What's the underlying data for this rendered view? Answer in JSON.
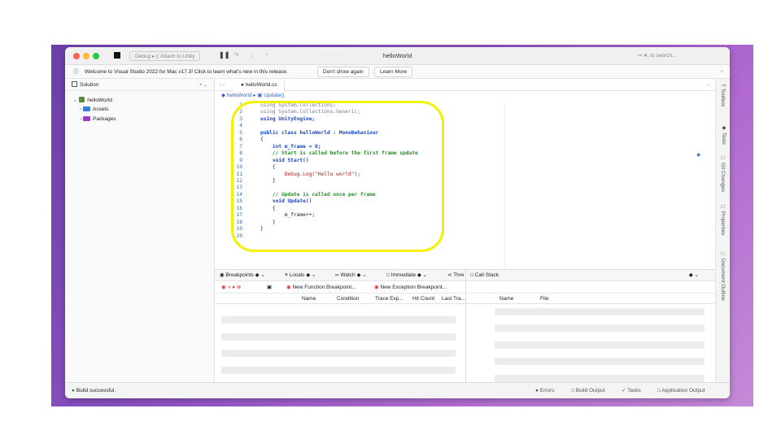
{
  "window": {
    "title": "helloWorld"
  },
  "toolbar": {
    "config": "Debug ▸ ▯ Attach to Unity",
    "search_placeholder": "⌕▾ ⌘. to search..."
  },
  "infobar": {
    "text": "Welcome to Visual Studio 2022 for Mac v17.3! Click to learn what's new in this release.",
    "dont_show": "Don't show again",
    "learn_more": "Learn More"
  },
  "solution": {
    "title": "Solution",
    "project": "helloWorld",
    "items": [
      "Assets",
      "Packages"
    ]
  },
  "editor": {
    "tab": "helloWorld.cs",
    "breadcrumb_file": "helloWorld ▸",
    "breadcrumb_member": "Update()"
  },
  "code": {
    "line_numbers": [
      "1",
      "2",
      "3",
      "4",
      "5",
      "6",
      "7",
      "8",
      "9",
      "10",
      "11",
      "12",
      "13",
      "14",
      "15",
      "16",
      "17",
      "18",
      "19",
      "20"
    ],
    "lines": [
      "using System.Collections;",
      "using System.Collections.Generic;",
      "using UnityEngine;",
      "",
      "public class helloWorld : MonoBehaviour",
      "{",
      "    int m_frame = 0;",
      "    // Start is called before the first frame update",
      "    void Start()",
      "    {",
      "        Debug.Log(\"Hello world\");",
      "    }",
      "",
      "    // Update is called once per frame",
      "    void Update()",
      "    {",
      "        m_frame++;",
      "    }",
      "}",
      ""
    ]
  },
  "right_tabs": [
    "Toolbox",
    "Tests",
    "Git Changes",
    "Properties",
    "Document Outline"
  ],
  "debug_pads": {
    "tabs": [
      "Breakpoints",
      "Locals",
      "Watch",
      "Immediate",
      "Thre"
    ],
    "call_stack": "Call Stack",
    "new_function_bp": "New Function Breakpoint...",
    "new_exception_bp": "New Exception Breakpoint...",
    "bp_columns": [
      "Name",
      "Condition",
      "Trace Exp...",
      "Hit Count",
      "Last Tra..."
    ],
    "cs_columns": [
      "Name",
      "File"
    ]
  },
  "status": {
    "message": "Build successful.",
    "items": [
      "Errors",
      "Build Output",
      "Tasks",
      "Application Output"
    ]
  },
  "colors": {
    "highlight": "#f5f000",
    "wallpaper": "#8a4fc0"
  }
}
